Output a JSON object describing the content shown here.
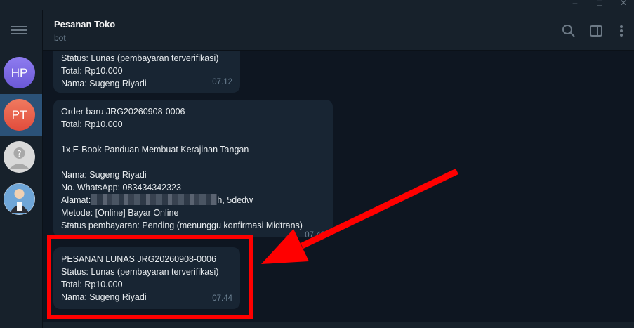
{
  "chat": {
    "title": "Pesanan Toko",
    "subtitle": "bot"
  },
  "sidebar": {
    "items": [
      {
        "initials": "HP",
        "color": "#7c6ae8",
        "active": false
      },
      {
        "initials": "PT",
        "color": "#e8644f",
        "active": true
      },
      {
        "initials": "",
        "icon": "unknown-user-avatar",
        "active": false
      },
      {
        "initials": "",
        "icon": "photo-avatar",
        "active": false
      }
    ]
  },
  "messages": [
    {
      "lines": [
        "Status: Lunas (pembayaran terverifikasi)",
        "Total: Rp10.000",
        "Nama: Sugeng Riyadi"
      ],
      "time": "07.12"
    },
    {
      "lines": [
        "Order baru JRG20260908-0006",
        "Total: Rp10.000",
        "",
        "1x E-Book Panduan Membuat Kerajinan Tangan",
        "",
        "Nama: Sugeng Riyadi",
        "No. WhatsApp: 083434342323",
        "Alamat:",
        "Metode: [Online] Bayar Online",
        "Status pembayaran: Pending (menunggu konfirmasi Midtrans)"
      ],
      "address_suffix": "h, 5dedw",
      "time": "07.42"
    },
    {
      "lines": [
        "PESANAN LUNAS JRG20260908-0006",
        "Status: Lunas (pembayaran terverifikasi)",
        "Total: Rp10.000",
        "Nama: Sugeng Riyadi"
      ],
      "time": "07.44"
    }
  ],
  "colors": {
    "annotation": "#ff0000",
    "active_chat": "#2b5278",
    "bubble": "#182533",
    "background": "#0e1621"
  }
}
